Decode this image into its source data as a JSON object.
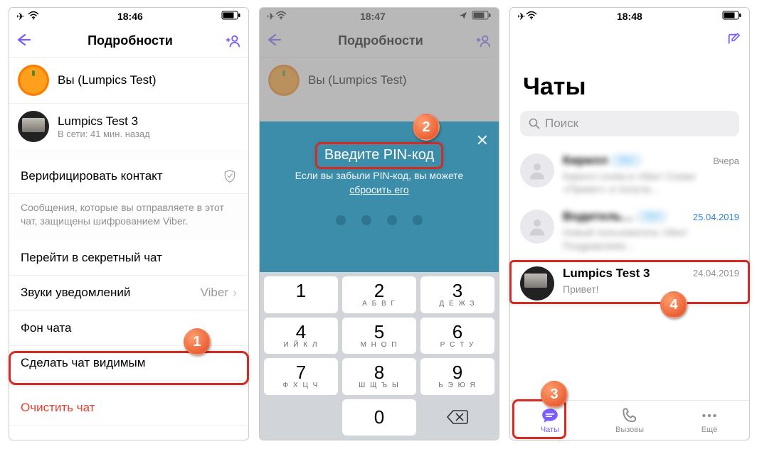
{
  "screen1": {
    "status": {
      "time": "18:46"
    },
    "nav": {
      "title": "Подробности"
    },
    "me": {
      "label": "Вы (Lumpics Test)"
    },
    "contact": {
      "name": "Lumpics Test 3",
      "status": "В сети: 41 мин. назад"
    },
    "verify": "Верифицировать контакт",
    "enc_note": "Сообщения, которые вы отправляете в этот чат, защищены шифрованием Viber.",
    "secret": "Перейти в секретный чат",
    "sounds": {
      "label": "Звуки уведомлений",
      "value": "Viber"
    },
    "bg": "Фон чата",
    "make_visible": "Сделать чат видимым",
    "clear": "Очистить чат"
  },
  "screen2": {
    "status": {
      "time": "18:47"
    },
    "nav": {
      "title": "Подробности"
    },
    "me": {
      "label": "Вы (Lumpics Test)"
    },
    "pin": {
      "prompt": "Введите PIN-код",
      "hint_pre": "Если вы забыли PIN-код, вы можете ",
      "reset": "сбросить его"
    },
    "keys": {
      "1": "1",
      "2": "2",
      "3": "3",
      "4": "4",
      "5": "5",
      "6": "6",
      "7": "7",
      "8": "8",
      "9": "9",
      "0": "0",
      "l2": "А Б В Г",
      "l3": "Д Е Ж З",
      "l4": "И Й К Л",
      "l5": "М Н О П",
      "l6": "Р С Т У",
      "l7": "Ф Х Ц Ч",
      "l8": "Ш Щ Ъ Ы",
      "l9": "Ь Э Ю Я"
    }
  },
  "screen3": {
    "status": {
      "time": "18:48"
    },
    "title": "Чаты",
    "search": "Поиск",
    "items": [
      {
        "name": "Кирилл",
        "tag": "Viber",
        "date": "Вчера",
        "msg": "Кирилл снова в Viber! Скажи «Привет» и получи…"
      },
      {
        "name": "Водитель…",
        "tag": "Viber",
        "date": "25.04.2019",
        "msg": "Новый пользователь Viber! Поздравляем…"
      },
      {
        "name": "Lumpics Test 3",
        "tag": "",
        "date": "24.04.2019",
        "msg": "Привет!"
      }
    ],
    "tabs": {
      "chats": "Чаты",
      "calls": "Вызовы",
      "more": "Ещё"
    }
  },
  "steps": {
    "1": "1",
    "2": "2",
    "3": "3",
    "4": "4"
  }
}
